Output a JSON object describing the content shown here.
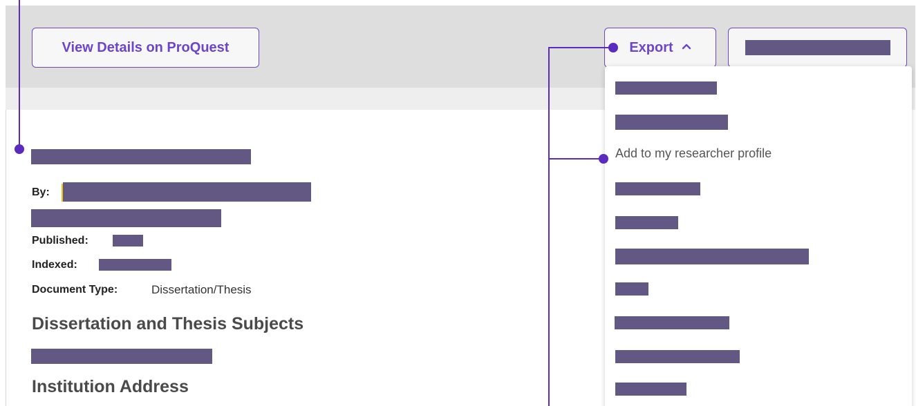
{
  "toolbar": {
    "view_details_label": "View Details on ProQuest",
    "export_label": "Export",
    "export_chevron": "chevron-up-icon"
  },
  "record": {
    "by_label": "By:",
    "published_label": "Published:",
    "indexed_label": "Indexed:",
    "doctype_label": "Document Type:",
    "doctype_value": "Dissertation/Thesis",
    "subjects_heading": "Dissertation and Thesis Subjects",
    "institution_heading": "Institution Address"
  },
  "export_menu": {
    "visible_item": "Add to my researcher profile"
  },
  "colors": {
    "accent": "#6d45c9",
    "annotation": "#5b2bc0",
    "redaction": "#635883",
    "toolbar_bg": "#dedede"
  }
}
